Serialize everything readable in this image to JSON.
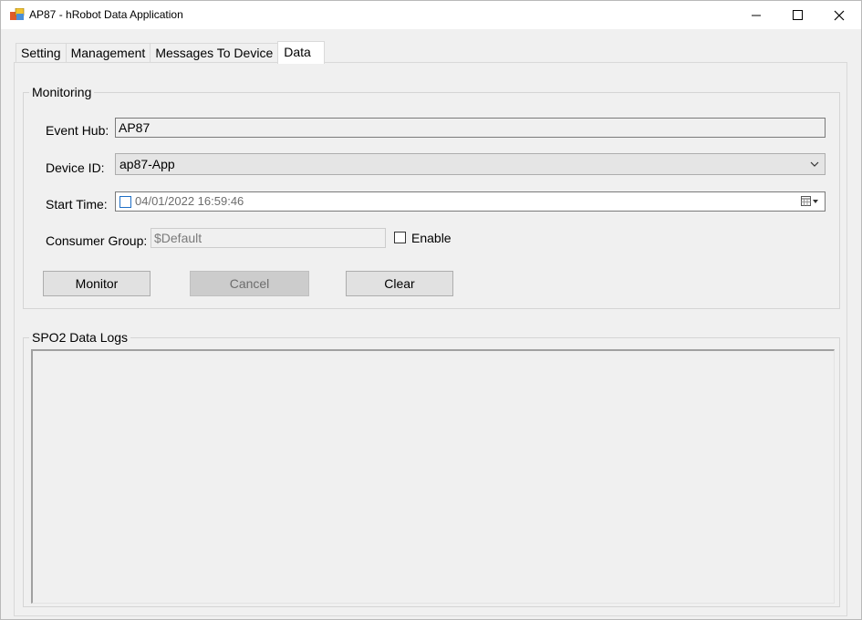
{
  "window": {
    "title": "AP87 - hRobot Data Application"
  },
  "tabs": [
    {
      "label": "Setting"
    },
    {
      "label": "Management"
    },
    {
      "label": "Messages To Device"
    },
    {
      "label": "Data"
    }
  ],
  "monitoring": {
    "group_title": "Monitoring",
    "event_hub_label": "Event Hub:",
    "event_hub_value": "AP87",
    "device_id_label": "Device ID:",
    "device_id_value": "ap87-App",
    "start_time_label": "Start Time:",
    "start_time_value": "04/01/2022 16:59:46",
    "consumer_group_label": "Consumer Group:",
    "consumer_group_value": "$Default",
    "enable_label": "Enable",
    "enable_checked": false,
    "monitor_button": "Monitor",
    "cancel_button": "Cancel",
    "clear_button": "Clear"
  },
  "logs": {
    "group_title": "SPO2 Data Logs"
  },
  "colors": {
    "window_bg": "#f0f0f0",
    "titlebar_bg": "#ffffff",
    "accent": "#1f6fc6"
  }
}
